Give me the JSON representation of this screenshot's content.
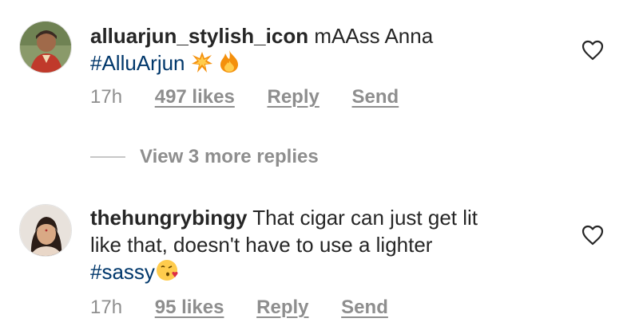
{
  "comments": [
    {
      "username": "alluarjun_stylish_icon",
      "text_line1": "mAAss Anna",
      "hashtag": "#AlluArjun",
      "emojis": [
        "collision-emoji",
        "fire-emoji"
      ],
      "time": "17h",
      "likes": "497 likes",
      "reply": "Reply",
      "send": "Send"
    },
    {
      "username": "thehungrybingy",
      "text_line1": "That cigar can just get lit",
      "text_line2": "like that, doesn't have to use a lighter",
      "hashtag": "#sassy",
      "emojis": [
        "face-blowing-kiss-emoji"
      ],
      "time": "17h",
      "likes": "95 likes",
      "reply": "Reply",
      "send": "Send"
    }
  ],
  "view_replies": "View 3 more replies",
  "colors": {
    "text": "#262626",
    "muted": "#8e8e8e",
    "hashtag": "#00376b"
  },
  "icons": [
    "heart-outline-icon"
  ]
}
